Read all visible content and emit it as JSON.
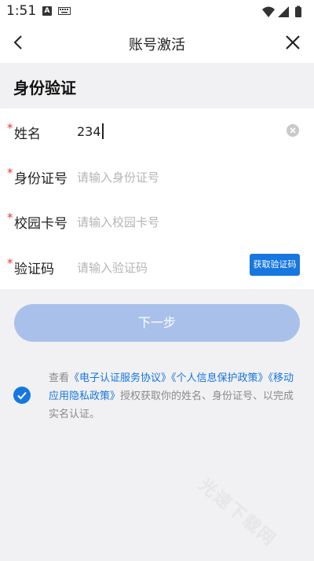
{
  "status_bar": {
    "time": "1:51",
    "notification_icon": "A"
  },
  "nav": {
    "title": "账号激活"
  },
  "section": {
    "title": "身份验证"
  },
  "form": {
    "required_mark": "*",
    "name": {
      "label": "姓名",
      "value": "234"
    },
    "id_number": {
      "label": "身份证号",
      "placeholder": "请输入身份证号"
    },
    "campus_card": {
      "label": "校园卡号",
      "placeholder": "请输入校园卡号"
    },
    "verify_code": {
      "label": "验证码",
      "placeholder": "请输入验证码",
      "button_label": "获取验证码"
    }
  },
  "next_button": {
    "label": "下一步"
  },
  "agreement": {
    "prefix": "查看",
    "link1": "《电子认证服务协议》",
    "link2": "《个人信息保护政策》",
    "link3": "《移动应用隐私政策》",
    "suffix": "授权获取你的姓名、身份证号、以完成实名认证。",
    "checked": true
  },
  "watermark": {
    "text": "光速下载网"
  },
  "colors": {
    "accent": "#1677e0",
    "required": "#e53935",
    "next_disabled": "#a9c1ea",
    "page_bg": "#f1f1f3"
  }
}
